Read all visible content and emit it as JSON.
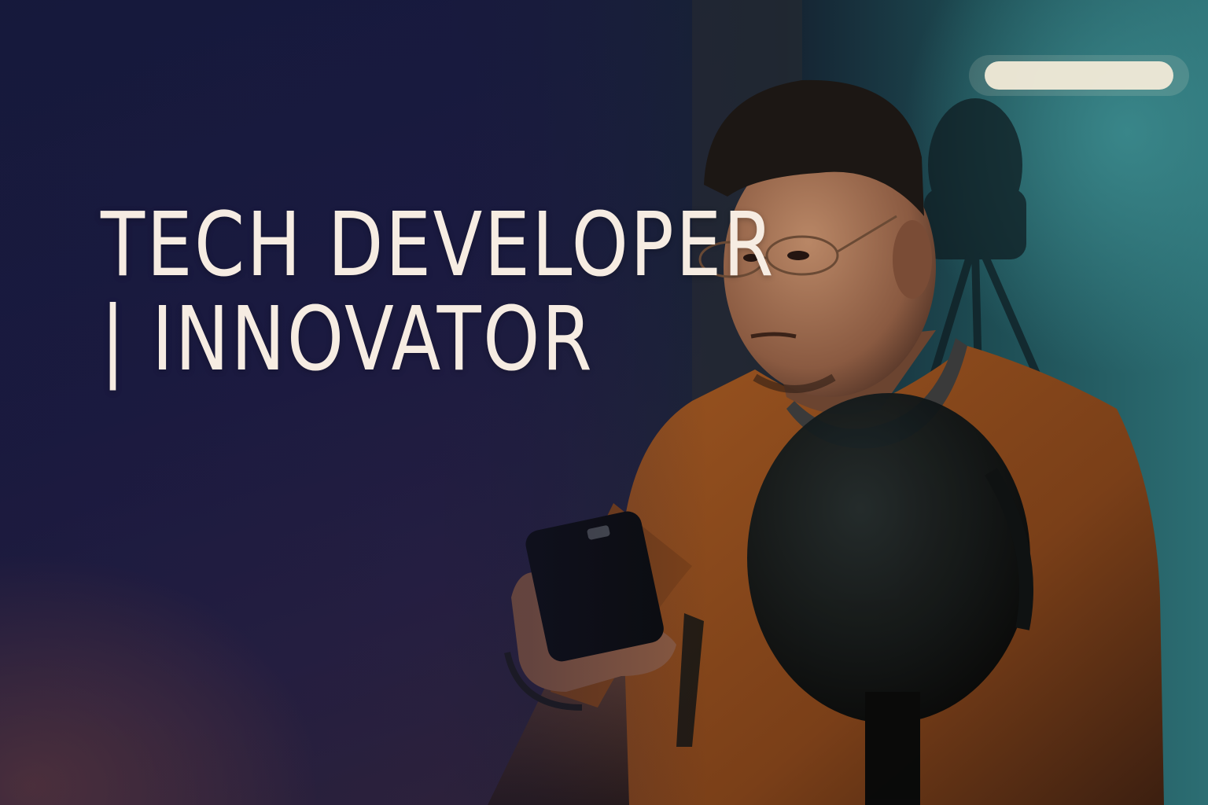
{
  "headline": {
    "line1": "TECH DEVELOPER",
    "line2": "| INNOVATOR"
  },
  "colors": {
    "headline_text": "#f6ece2",
    "background_navy": "#141a3d",
    "background_plum": "#3d2838",
    "accent_teal": "#2f6f73",
    "shirt_orange": "#9a5420"
  },
  "scene": {
    "subject": "young man with glasses holding a smartphone",
    "icons": [
      "smartphone-icon",
      "microphone-icon",
      "ceiling-light-icon"
    ]
  }
}
